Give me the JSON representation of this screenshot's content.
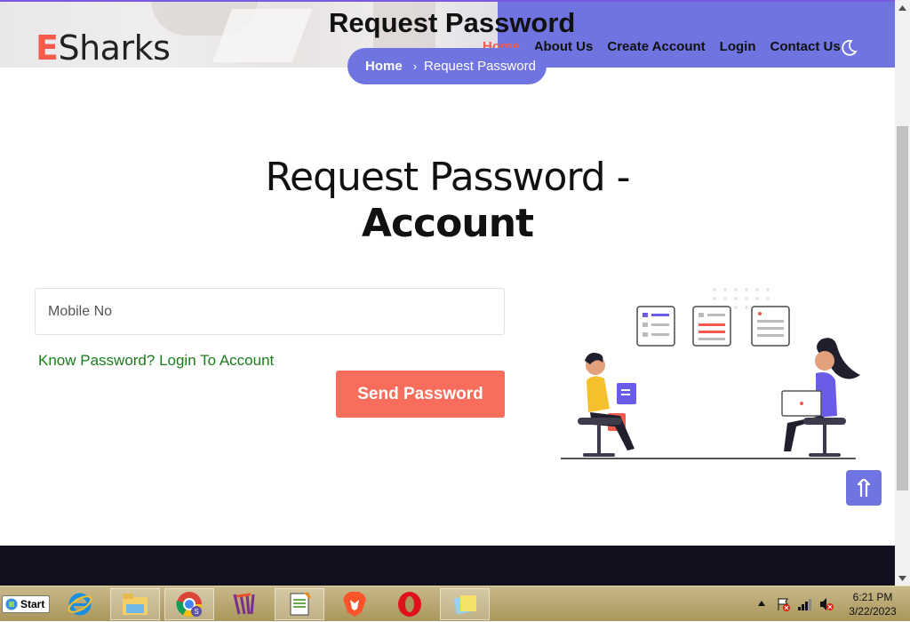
{
  "header": {
    "logo_prefix": "E",
    "logo_rest": "Sharks",
    "page_heading": "Request Password",
    "nav": [
      {
        "label": "Home",
        "active": true
      },
      {
        "label": "About Us"
      },
      {
        "label": "Create Account"
      },
      {
        "label": "Login"
      },
      {
        "label": "Contact Us"
      }
    ],
    "theme_icon": "moon-icon"
  },
  "breadcrumb": {
    "home": "Home",
    "separator": "›",
    "current": "Request Password"
  },
  "main": {
    "title_line1": "Request Password -",
    "title_line2": "Account",
    "mobile_placeholder": "Mobile No",
    "mobile_value": "",
    "login_link": "Know Password? Login To Account",
    "send_button": "Send Password"
  },
  "colors": {
    "accent": "#6f74e1",
    "brand_red": "#f25b4c",
    "button": "#f96d5c",
    "link_green": "#1a7d1a",
    "footer": "#120f1f"
  },
  "taskbar": {
    "start_label": "Start",
    "apps": [
      "internet-explorer-icon",
      "file-explorer-icon",
      "chrome-icon",
      "winrar-icon",
      "notepad-plus-plus-icon",
      "brave-icon",
      "opera-icon",
      "sticky-notes-icon"
    ],
    "clock_time": "6:21 PM",
    "clock_date": "3/22/2023"
  }
}
